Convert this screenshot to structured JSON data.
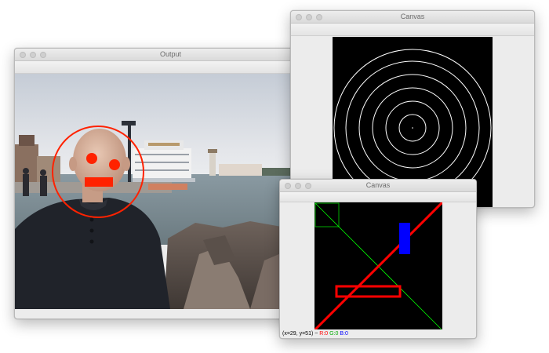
{
  "windows": {
    "output": {
      "title": "Output"
    },
    "canvas_rings": {
      "title": "Canvas"
    },
    "canvas_shapes": {
      "title": "Canvas",
      "status": {
        "coords": "(x=29, y=51) ~",
        "r": "R:0",
        "g": "G:0",
        "b": "B:0"
      }
    }
  },
  "colors": {
    "annotation_red": "#ff2200",
    "canvas_bg": "#000000",
    "ring_color": "#ffffff",
    "line_green": "#00ff00",
    "rect_blue": "#0000ff",
    "rect_red": "#ff0000"
  },
  "icons": {
    "window_controls": [
      "close-icon",
      "minimize-icon",
      "zoom-icon"
    ]
  }
}
